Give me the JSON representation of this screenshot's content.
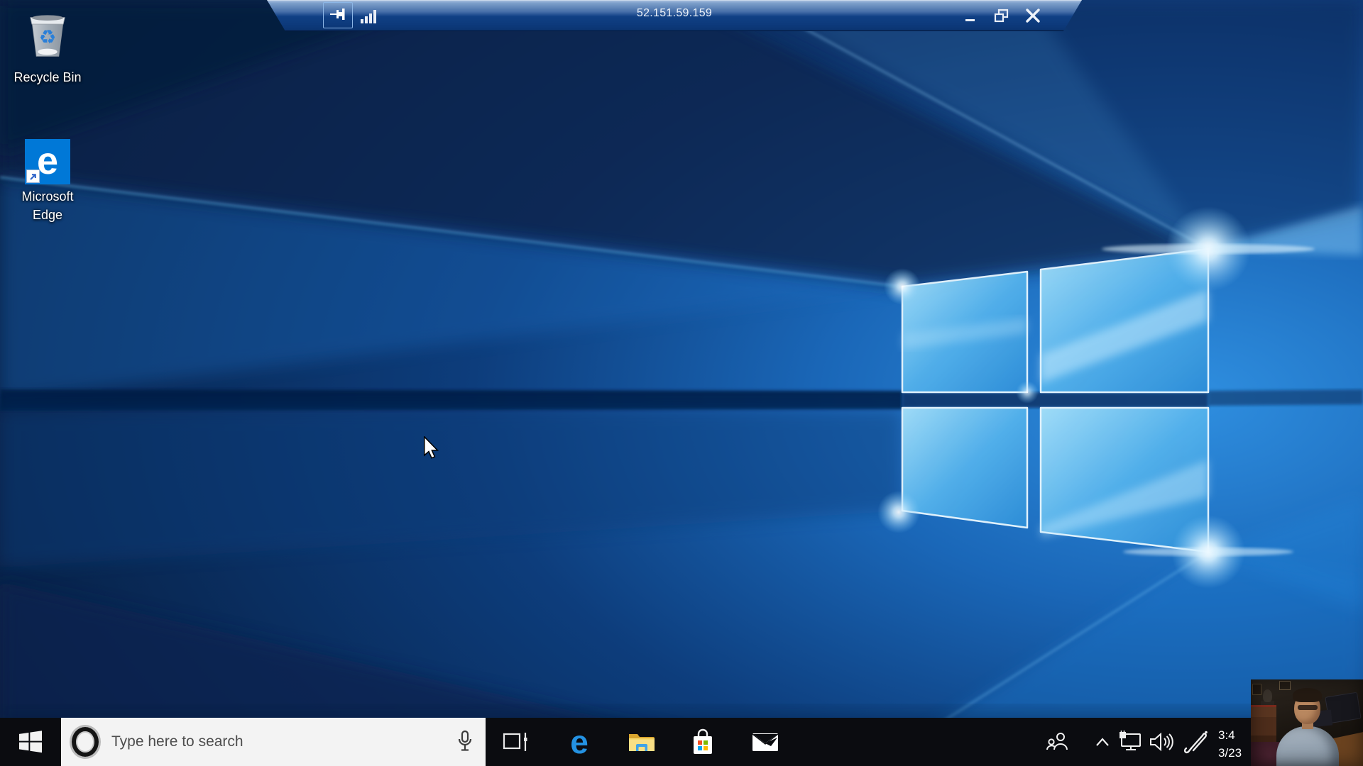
{
  "connection_bar": {
    "address": "52.151.59.159"
  },
  "desktop": {
    "recycle_bin_label": "Recycle Bin",
    "edge_label": "Microsoft Edge"
  },
  "taskbar": {
    "search_placeholder": "Type here to search",
    "clock": {
      "time": "3:4",
      "date": "3/23"
    }
  },
  "icons": {
    "edge_letter": "e",
    "recycle_glyph": "♻",
    "connection_bar": [
      "pin-icon",
      "signal-bars-icon",
      "minimize-icon",
      "restore-down-icon",
      "close-icon"
    ],
    "taskbar_left": [
      "start-icon",
      "cortana-icon",
      "microphone-icon"
    ],
    "taskbar_apps": [
      "task-view-icon",
      "edge-icon",
      "file-explorer-icon",
      "microsoft-store-icon",
      "mail-icon"
    ],
    "tray": [
      "people-icon",
      "hidden-icons-chevron-icon",
      "network-icon",
      "volume-icon",
      "windows-ink-pen-icon"
    ]
  },
  "colors": {
    "taskbar_bg": "#0b0c10",
    "search_box_bg": "#f3f3f3",
    "search_text": "#4d4d4d",
    "connection_bar_top": "#8fadd6",
    "connection_bar_bottom": "#0b3876",
    "edge_blue": "#0078d7",
    "wallpaper_dark": "#071f42",
    "wallpaper_bright": "#2f8fe0",
    "store_red": "#f25022",
    "store_green": "#7fba00",
    "store_blue": "#00a4ef",
    "store_yellow": "#ffb900"
  }
}
